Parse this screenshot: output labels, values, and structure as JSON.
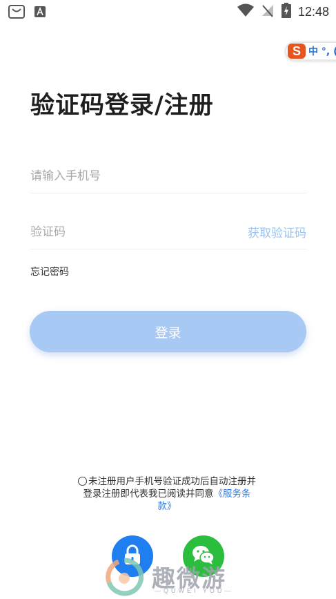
{
  "status_bar": {
    "time": "12:48"
  },
  "ime": {
    "logo": "S",
    "text": "中 °, ("
  },
  "page": {
    "title": "验证码登录/注册"
  },
  "phone": {
    "placeholder": "请输入手机号",
    "value": ""
  },
  "code": {
    "placeholder": "验证码",
    "value": "",
    "get_code_label": "获取验证码"
  },
  "forgot_label": "忘记密码",
  "login_label": "登录",
  "agreement": {
    "line1": "未注册用户手机号验证成功后自动注册并",
    "line2": "登录注册即代表我已阅读并同意",
    "link_part1": "《服务条",
    "link_part2": "款》"
  },
  "alt_login": {
    "lock_icon": "lock-icon",
    "wechat_icon": "wechat-icon"
  },
  "watermark": {
    "text": "趣微游",
    "sub": "—QUWEI YOU—"
  },
  "colors": {
    "primary": "#1f7ef0",
    "button_disabled": "#a8c9f4",
    "link": "#2f7fe0",
    "wechat": "#2bbd3d",
    "ime": "#e8541e"
  }
}
